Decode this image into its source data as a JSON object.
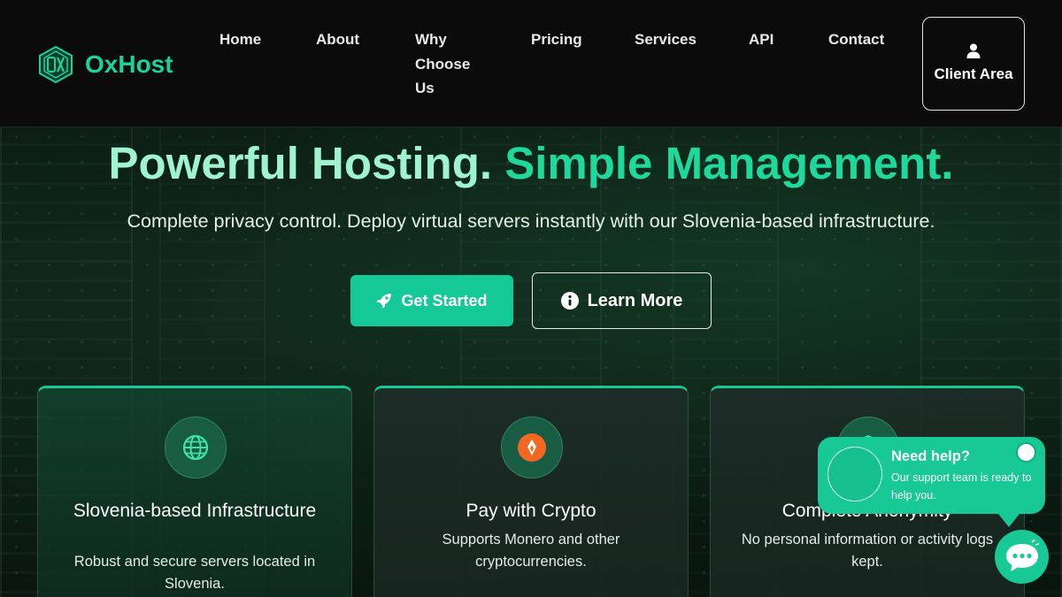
{
  "brand": {
    "name": "OxHost",
    "accent": "#19d39b",
    "button_green": "#14c997"
  },
  "nav": {
    "items": [
      {
        "label": "Home"
      },
      {
        "label": "About"
      },
      {
        "label": "Why Choose Us"
      },
      {
        "label": "Pricing"
      },
      {
        "label": "Services"
      },
      {
        "label": "API"
      },
      {
        "label": "Contact"
      }
    ],
    "client_area": {
      "label": "Client Area",
      "icon": "user-icon"
    }
  },
  "hero": {
    "title_part1": "Powerful Hosting.",
    "title_part2": "Simple Management.",
    "subtitle": "Complete privacy control. Deploy virtual servers instantly with our Slovenia-based infrastructure.",
    "primary_button": {
      "label": "Get Started",
      "icon": "rocket-icon"
    },
    "secondary_button": {
      "label": "Learn More",
      "icon": "info-circle-icon"
    }
  },
  "features": [
    {
      "title": "Slovenia-based Infrastructure",
      "description": "Robust and secure servers located in Slovenia.",
      "icon": "globe-icon"
    },
    {
      "title": "Pay with Crypto",
      "description": "Supports Monero and other cryptocurrencies.",
      "icon": "monero-icon"
    },
    {
      "title": "Complete Anonymity",
      "description": "No personal information or activity logs kept.",
      "icon": "shield-icon"
    }
  ],
  "chat": {
    "title": "Need help?",
    "text": "Our support team is ready to help you.",
    "launcher_icon": "chat-icon"
  }
}
